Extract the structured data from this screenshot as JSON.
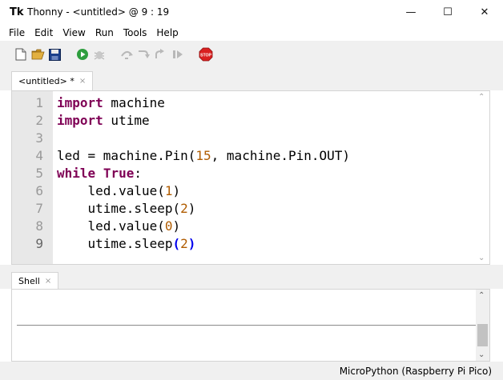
{
  "window": {
    "app_icon": "Tk",
    "title": "Thonny  -  <untitled>  @  9 : 19",
    "minimize": "—",
    "maximize": "☐",
    "close": "✕"
  },
  "menu": [
    "File",
    "Edit",
    "View",
    "Run",
    "Tools",
    "Help"
  ],
  "toolbar": {
    "icons": [
      "new-file-icon",
      "open-folder-icon",
      "save-icon",
      "run-icon",
      "debug-icon",
      "step-over-icon",
      "step-into-icon",
      "step-out-icon",
      "resume-icon",
      "stop-icon"
    ],
    "stop_label": "STOP",
    "colors": {
      "run": "#2e9e3e",
      "stop": "#d92020",
      "save": "#1a3f8a",
      "folder": "#e2b040",
      "disabled": "#b8b8b8"
    }
  },
  "editor": {
    "tab_label": "<untitled> *",
    "tab_close": "×",
    "line_numbers": [
      "1",
      "2",
      "3",
      "4",
      "5",
      "6",
      "7",
      "8",
      "9"
    ],
    "current_line": 9,
    "lines": [
      [
        {
          "t": "import",
          "c": "kw"
        },
        {
          "t": " machine"
        }
      ],
      [
        {
          "t": "import",
          "c": "kw"
        },
        {
          "t": " utime"
        }
      ],
      [],
      [
        {
          "t": "led = machine.Pin("
        },
        {
          "t": "15",
          "c": "num"
        },
        {
          "t": ", machine.Pin.OUT)"
        }
      ],
      [
        {
          "t": "while",
          "c": "kw"
        },
        {
          "t": " "
        },
        {
          "t": "True",
          "c": "kw"
        },
        {
          "t": ":"
        }
      ],
      [
        {
          "t": "    led.value("
        },
        {
          "t": "1",
          "c": "num"
        },
        {
          "t": ")"
        }
      ],
      [
        {
          "t": "    utime.sleep("
        },
        {
          "t": "2",
          "c": "num"
        },
        {
          "t": ")"
        }
      ],
      [
        {
          "t": "    led.value("
        },
        {
          "t": "0",
          "c": "num"
        },
        {
          "t": ")"
        }
      ],
      [
        {
          "t": "    utime.sleep"
        },
        {
          "t": "(",
          "c": "paren-hl"
        },
        {
          "t": "2",
          "c": "num"
        },
        {
          "t": ")",
          "c": "paren-hl"
        }
      ]
    ],
    "colors": {
      "keyword": "#7f0055",
      "number": "#b05c00",
      "bracket_match": "#0000ee",
      "gutter": "#e8e8e8"
    }
  },
  "shell": {
    "tab_label": "Shell",
    "tab_close": "×"
  },
  "scroll": {
    "up": "⌃",
    "down": "⌄"
  },
  "status": {
    "interpreter": "MicroPython (Raspberry Pi Pico)"
  }
}
